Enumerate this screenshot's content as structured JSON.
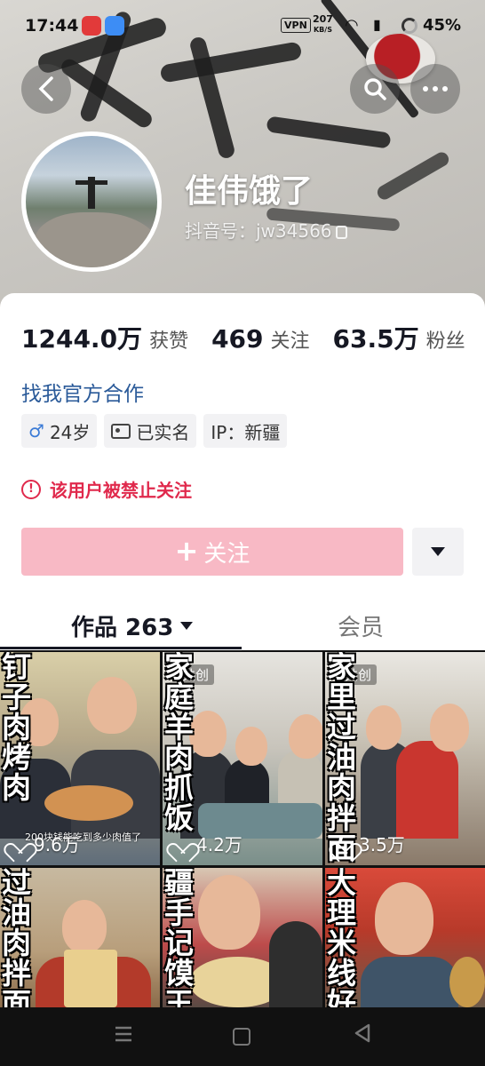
{
  "status_bar": {
    "time": "17:44",
    "vpn": "VPN",
    "speed_value": "207",
    "speed_unit": "KB/S",
    "battery": "45%"
  },
  "header": {
    "nickname": "佳伟饿了",
    "account_label": "抖音号：jw34566"
  },
  "stats": [
    {
      "value": "1244.0万",
      "label": "获赞"
    },
    {
      "value": "469",
      "label": "关注"
    },
    {
      "value": "63.5万",
      "label": "粉丝"
    }
  ],
  "profile": {
    "link_text": "找我官方合作",
    "tags": {
      "age": "24岁",
      "gender_symbol": "♂",
      "verified": "已实名",
      "ip": "IP：新疆"
    },
    "warning": "该用户被禁止关注"
  },
  "actions": {
    "follow_label": "关注"
  },
  "tabs": {
    "works": "作品 263",
    "member": "会员"
  },
  "videos": [
    {
      "title": "钉子肉烤肉",
      "likes": "9.6万",
      "caption": "200块钱能吃到多少肉值了",
      "badge": ""
    },
    {
      "title": "家庭羊肉抓饭",
      "likes": "4.2万",
      "caption": "",
      "badge": "共创"
    },
    {
      "title": "家里过油肉拌面",
      "likes": "3.5万",
      "caption": "",
      "badge": "共创"
    },
    {
      "title": "过油肉拌面",
      "likes": "",
      "caption": "",
      "badge": ""
    },
    {
      "title": "疆手记馍王",
      "likes": "",
      "caption": "",
      "badge": ""
    },
    {
      "title": "大理米线好",
      "likes": "",
      "caption": "",
      "badge": ""
    }
  ],
  "colors": {
    "accent_link": "#2a5a99",
    "warning": "#e0294c",
    "follow_disabled": "#f8b9c5"
  }
}
